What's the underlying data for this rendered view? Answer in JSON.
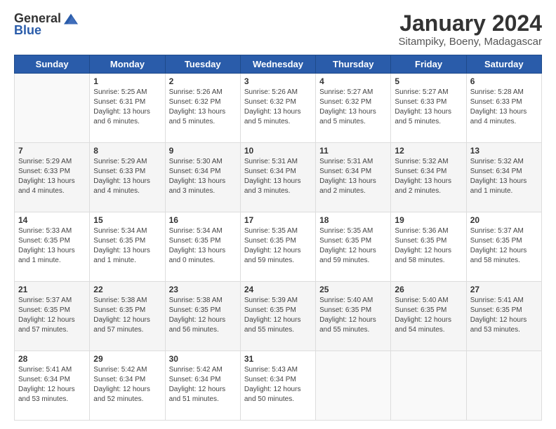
{
  "logo": {
    "general": "General",
    "blue": "Blue"
  },
  "header": {
    "title": "January 2024",
    "subtitle": "Sitampiky, Boeny, Madagascar"
  },
  "days_of_week": [
    "Sunday",
    "Monday",
    "Tuesday",
    "Wednesday",
    "Thursday",
    "Friday",
    "Saturday"
  ],
  "weeks": [
    [
      {
        "day": "",
        "info": ""
      },
      {
        "day": "1",
        "info": "Sunrise: 5:25 AM\nSunset: 6:31 PM\nDaylight: 13 hours\nand 6 minutes."
      },
      {
        "day": "2",
        "info": "Sunrise: 5:26 AM\nSunset: 6:32 PM\nDaylight: 13 hours\nand 5 minutes."
      },
      {
        "day": "3",
        "info": "Sunrise: 5:26 AM\nSunset: 6:32 PM\nDaylight: 13 hours\nand 5 minutes."
      },
      {
        "day": "4",
        "info": "Sunrise: 5:27 AM\nSunset: 6:32 PM\nDaylight: 13 hours\nand 5 minutes."
      },
      {
        "day": "5",
        "info": "Sunrise: 5:27 AM\nSunset: 6:33 PM\nDaylight: 13 hours\nand 5 minutes."
      },
      {
        "day": "6",
        "info": "Sunrise: 5:28 AM\nSunset: 6:33 PM\nDaylight: 13 hours\nand 4 minutes."
      }
    ],
    [
      {
        "day": "7",
        "info": "Sunrise: 5:29 AM\nSunset: 6:33 PM\nDaylight: 13 hours\nand 4 minutes."
      },
      {
        "day": "8",
        "info": "Sunrise: 5:29 AM\nSunset: 6:33 PM\nDaylight: 13 hours\nand 4 minutes."
      },
      {
        "day": "9",
        "info": "Sunrise: 5:30 AM\nSunset: 6:34 PM\nDaylight: 13 hours\nand 3 minutes."
      },
      {
        "day": "10",
        "info": "Sunrise: 5:31 AM\nSunset: 6:34 PM\nDaylight: 13 hours\nand 3 minutes."
      },
      {
        "day": "11",
        "info": "Sunrise: 5:31 AM\nSunset: 6:34 PM\nDaylight: 13 hours\nand 2 minutes."
      },
      {
        "day": "12",
        "info": "Sunrise: 5:32 AM\nSunset: 6:34 PM\nDaylight: 13 hours\nand 2 minutes."
      },
      {
        "day": "13",
        "info": "Sunrise: 5:32 AM\nSunset: 6:34 PM\nDaylight: 13 hours\nand 1 minute."
      }
    ],
    [
      {
        "day": "14",
        "info": "Sunrise: 5:33 AM\nSunset: 6:35 PM\nDaylight: 13 hours\nand 1 minute."
      },
      {
        "day": "15",
        "info": "Sunrise: 5:34 AM\nSunset: 6:35 PM\nDaylight: 13 hours\nand 1 minute."
      },
      {
        "day": "16",
        "info": "Sunrise: 5:34 AM\nSunset: 6:35 PM\nDaylight: 13 hours\nand 0 minutes."
      },
      {
        "day": "17",
        "info": "Sunrise: 5:35 AM\nSunset: 6:35 PM\nDaylight: 12 hours\nand 59 minutes."
      },
      {
        "day": "18",
        "info": "Sunrise: 5:35 AM\nSunset: 6:35 PM\nDaylight: 12 hours\nand 59 minutes."
      },
      {
        "day": "19",
        "info": "Sunrise: 5:36 AM\nSunset: 6:35 PM\nDaylight: 12 hours\nand 58 minutes."
      },
      {
        "day": "20",
        "info": "Sunrise: 5:37 AM\nSunset: 6:35 PM\nDaylight: 12 hours\nand 58 minutes."
      }
    ],
    [
      {
        "day": "21",
        "info": "Sunrise: 5:37 AM\nSunset: 6:35 PM\nDaylight: 12 hours\nand 57 minutes."
      },
      {
        "day": "22",
        "info": "Sunrise: 5:38 AM\nSunset: 6:35 PM\nDaylight: 12 hours\nand 57 minutes."
      },
      {
        "day": "23",
        "info": "Sunrise: 5:38 AM\nSunset: 6:35 PM\nDaylight: 12 hours\nand 56 minutes."
      },
      {
        "day": "24",
        "info": "Sunrise: 5:39 AM\nSunset: 6:35 PM\nDaylight: 12 hours\nand 55 minutes."
      },
      {
        "day": "25",
        "info": "Sunrise: 5:40 AM\nSunset: 6:35 PM\nDaylight: 12 hours\nand 55 minutes."
      },
      {
        "day": "26",
        "info": "Sunrise: 5:40 AM\nSunset: 6:35 PM\nDaylight: 12 hours\nand 54 minutes."
      },
      {
        "day": "27",
        "info": "Sunrise: 5:41 AM\nSunset: 6:35 PM\nDaylight: 12 hours\nand 53 minutes."
      }
    ],
    [
      {
        "day": "28",
        "info": "Sunrise: 5:41 AM\nSunset: 6:34 PM\nDaylight: 12 hours\nand 53 minutes."
      },
      {
        "day": "29",
        "info": "Sunrise: 5:42 AM\nSunset: 6:34 PM\nDaylight: 12 hours\nand 52 minutes."
      },
      {
        "day": "30",
        "info": "Sunrise: 5:42 AM\nSunset: 6:34 PM\nDaylight: 12 hours\nand 51 minutes."
      },
      {
        "day": "31",
        "info": "Sunrise: 5:43 AM\nSunset: 6:34 PM\nDaylight: 12 hours\nand 50 minutes."
      },
      {
        "day": "",
        "info": ""
      },
      {
        "day": "",
        "info": ""
      },
      {
        "day": "",
        "info": ""
      }
    ]
  ]
}
